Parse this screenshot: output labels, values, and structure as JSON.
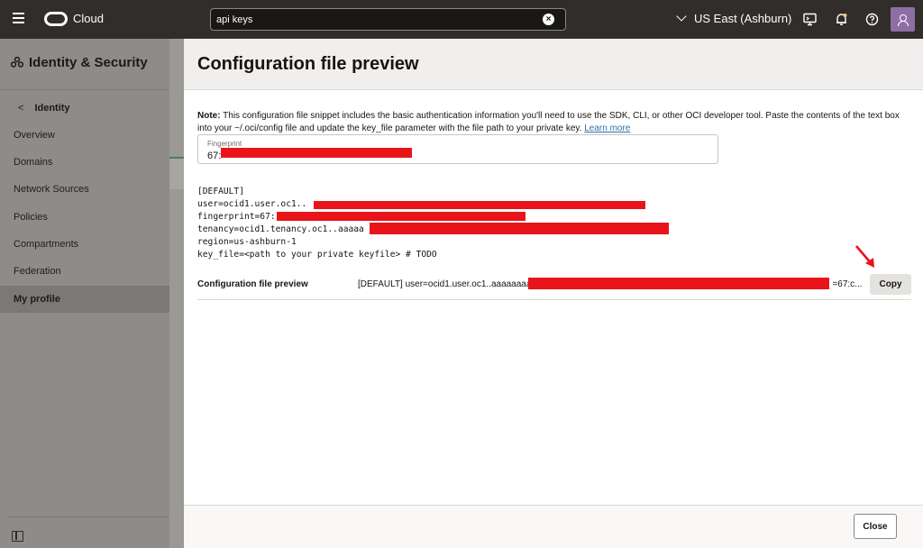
{
  "topbar": {
    "brand": "Cloud",
    "search_value": "api keys",
    "region": "US East (Ashburn)",
    "icons": [
      "menu-icon",
      "oracle-logo-icon",
      "clear-search-icon",
      "chevron-down-icon",
      "cloud-shell-icon",
      "bell-icon",
      "help-icon",
      "user-avatar-icon"
    ]
  },
  "sidebar": {
    "title": "Identity & Security",
    "back_label": "Identity",
    "items": [
      {
        "label": "Overview",
        "active": false
      },
      {
        "label": "Domains",
        "active": false
      },
      {
        "label": "Network Sources",
        "active": false
      },
      {
        "label": "Policies",
        "active": false
      },
      {
        "label": "Compartments",
        "active": false
      },
      {
        "label": "Federation",
        "active": false
      },
      {
        "label": "My profile",
        "active": true
      }
    ]
  },
  "panel": {
    "title": "Configuration file preview",
    "note_label": "Note:",
    "note_text": " This configuration file snippet includes the basic authentication information you'll need to use the SDK, CLI, or other OCI developer tool. Paste the contents of the text box into your ~/.oci/config file and update the key_file parameter with the file path to your private key. ",
    "note_link": "Learn more",
    "fingerprint_label": "Fingerprint",
    "fingerprint_value": "67:",
    "config_lines": [
      "[DEFAULT]",
      "user=ocid1.user.oc1..",
      "fingerprint=67:",
      "tenancy=ocid1.tenancy.oc1..aaaaa",
      "region=us-ashburn-1",
      "key_file=<path to your private keyfile> # TODO"
    ],
    "preview_label": "Configuration file preview",
    "preview_value_start": "[DEFAULT] user=ocid1.user.oc1..aaaaaaaa",
    "preview_value_end": "=67:c...",
    "copy_label": "Copy",
    "close_label": "Close"
  },
  "colors": {
    "topbar": "#312d2a",
    "sidebar": "#8e8c89",
    "redaction": "#e8141a",
    "link": "#2f6fa8",
    "avatar": "#8e6fa5"
  }
}
